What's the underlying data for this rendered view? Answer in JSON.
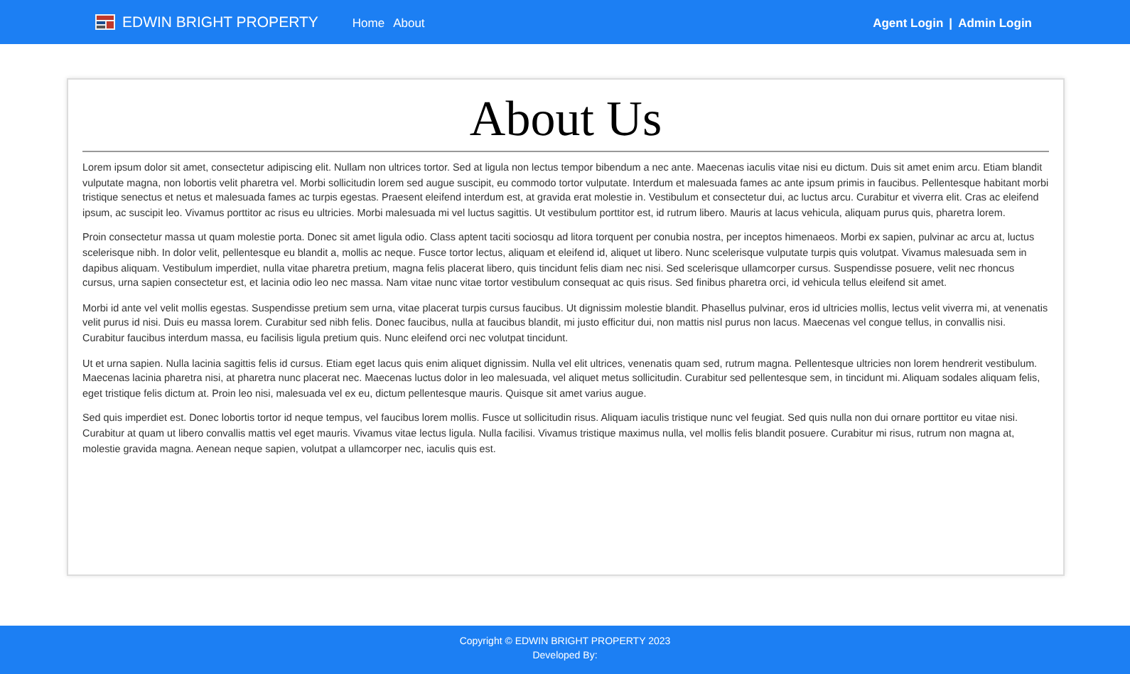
{
  "navbar": {
    "brand": "EDWIN BRIGHT PROPERTY",
    "links": [
      {
        "label": "Home"
      },
      {
        "label": "About"
      }
    ],
    "logins": [
      "Agent Login",
      "|",
      "Admin Login"
    ]
  },
  "page": {
    "title": "About Us",
    "paragraphs": [
      "Lorem ipsum dolor sit amet, consectetur adipiscing elit. Nullam non ultrices tortor. Sed at ligula non lectus tempor bibendum a nec ante. Maecenas iaculis vitae nisi eu dictum. Duis sit amet enim arcu. Etiam blandit vulputate magna, non lobortis velit pharetra vel. Morbi sollicitudin lorem sed augue suscipit, eu commodo tortor vulputate. Interdum et malesuada fames ac ante ipsum primis in faucibus. Pellentesque habitant morbi tristique senectus et netus et malesuada fames ac turpis egestas. Praesent eleifend interdum est, at gravida erat molestie in. Vestibulum et consectetur dui, ac luctus arcu. Curabitur et viverra elit. Cras ac eleifend ipsum, ac suscipit leo. Vivamus porttitor ac risus eu ultricies. Morbi malesuada mi vel luctus sagittis. Ut vestibulum porttitor est, id rutrum libero. Mauris at lacus vehicula, aliquam purus quis, pharetra lorem.",
      "Proin consectetur massa ut quam molestie porta. Donec sit amet ligula odio. Class aptent taciti sociosqu ad litora torquent per conubia nostra, per inceptos himenaeos. Morbi ex sapien, pulvinar ac arcu at, luctus scelerisque nibh. In dolor velit, pellentesque eu blandit a, mollis ac neque. Fusce tortor lectus, aliquam et eleifend id, aliquet ut libero. Nunc scelerisque vulputate turpis quis volutpat. Vivamus malesuada sem in dapibus aliquam. Vestibulum imperdiet, nulla vitae pharetra pretium, magna felis placerat libero, quis tincidunt felis diam nec nisi. Sed scelerisque ullamcorper cursus. Suspendisse posuere, velit nec rhoncus cursus, urna sapien consectetur est, et lacinia odio leo nec massa. Nam vitae nunc vitae tortor vestibulum consequat ac quis risus. Sed finibus pharetra orci, id vehicula tellus eleifend sit amet.",
      "Morbi id ante vel velit mollis egestas. Suspendisse pretium sem urna, vitae placerat turpis cursus faucibus. Ut dignissim molestie blandit. Phasellus pulvinar, eros id ultricies mollis, lectus velit viverra mi, at venenatis velit purus id nisi. Duis eu massa lorem. Curabitur sed nibh felis. Donec faucibus, nulla at faucibus blandit, mi justo efficitur dui, non mattis nisl purus non lacus. Maecenas vel congue tellus, in convallis nisi. Curabitur faucibus interdum massa, eu facilisis ligula pretium quis. Nunc eleifend orci nec volutpat tincidunt.",
      "Ut et urna sapien. Nulla lacinia sagittis felis id cursus. Etiam eget lacus quis enim aliquet dignissim. Nulla vel elit ultrices, venenatis quam sed, rutrum magna. Pellentesque ultricies non lorem hendrerit vestibulum. Maecenas lacinia pharetra nisi, at pharetra nunc placerat nec. Maecenas luctus dolor in leo malesuada, vel aliquet metus sollicitudin. Curabitur sed pellentesque sem, in tincidunt mi. Aliquam sodales aliquam felis, eget tristique felis dictum at. Proin leo nisi, malesuada vel ex eu, dictum pellentesque mauris. Quisque sit amet varius augue.",
      "Sed quis imperdiet est. Donec lobortis tortor id neque tempus, vel faucibus lorem mollis. Fusce ut sollicitudin risus. Aliquam iaculis tristique nunc vel feugiat. Sed quis nulla non dui ornare porttitor eu vitae nisi. Curabitur at quam ut libero convallis mattis vel eget mauris. Vivamus vitae lectus ligula. Nulla facilisi. Vivamus tristique maximus nulla, vel mollis felis blandit posuere. Curabitur mi risus, rutrum non magna at, molestie gravida magna. Aenean neque sapien, volutpat a ullamcorper nec, iaculis quis est."
    ]
  },
  "footer": {
    "lines": [
      "Copyright © EDWIN BRIGHT PROPERTY 2023",
      "Developed By:"
    ]
  }
}
